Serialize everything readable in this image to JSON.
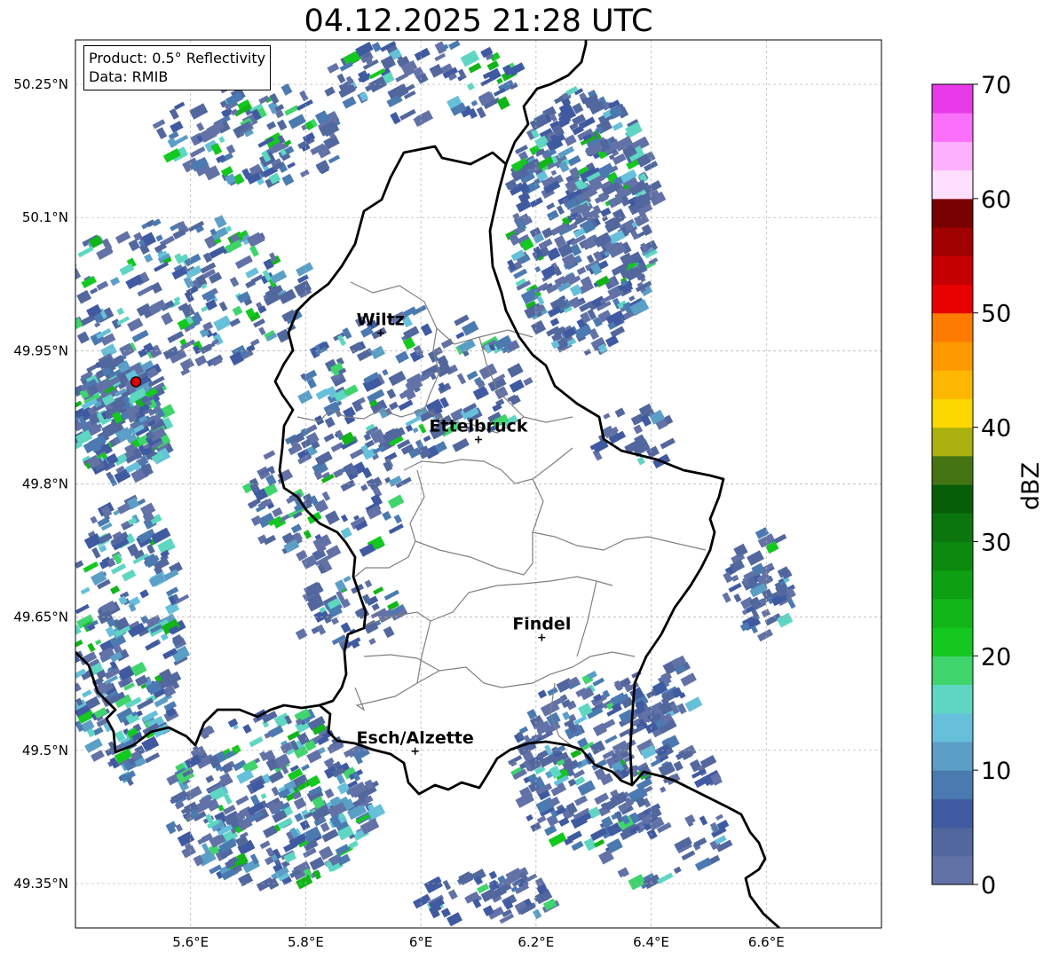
{
  "title": "04.12.2025 21:28 UTC",
  "info_box": {
    "product": "Product: 0.5° Reflectivity",
    "data": "Data: RMIB"
  },
  "map": {
    "lon_range": [
      5.4,
      6.8
    ],
    "lat_range": [
      49.3,
      50.3
    ],
    "x_ticks": [
      {
        "value": 5.6,
        "label": "5.6°E"
      },
      {
        "value": 5.8,
        "label": "5.8°E"
      },
      {
        "value": 6.0,
        "label": "6°E"
      },
      {
        "value": 6.2,
        "label": "6.2°E"
      },
      {
        "value": 6.4,
        "label": "6.4°E"
      },
      {
        "value": 6.6,
        "label": "6.6°E"
      }
    ],
    "y_ticks": [
      {
        "value": 50.25,
        "label": "50.25°N"
      },
      {
        "value": 50.1,
        "label": "50.1°N"
      },
      {
        "value": 49.95,
        "label": "49.95°N"
      },
      {
        "value": 49.8,
        "label": "49.8°N"
      },
      {
        "value": 49.65,
        "label": "49.65°N"
      },
      {
        "value": 49.5,
        "label": "49.5°N"
      },
      {
        "value": 49.35,
        "label": "49.35°N"
      }
    ],
    "grid": true,
    "cities": [
      {
        "name": "Wiltz",
        "lon": 5.93,
        "lat": 49.97
      },
      {
        "name": "Ettelbruck",
        "lon": 6.1,
        "lat": 49.85
      },
      {
        "name": "Findel",
        "lon": 6.21,
        "lat": 49.627
      },
      {
        "name": "Esch/Alzette",
        "lon": 5.99,
        "lat": 49.499
      }
    ],
    "radar_site": {
      "lon": 5.505,
      "lat": 49.915,
      "color": "#e00000"
    }
  },
  "colorbar": {
    "label": "dBZ",
    "min": 0,
    "max": 70,
    "step": 2.5,
    "tick_values": [
      0,
      10,
      20,
      30,
      40,
      50,
      60,
      70
    ],
    "tick_labels": [
      "0",
      "10",
      "20",
      "30",
      "40",
      "50",
      "60",
      "70"
    ],
    "colors": [
      "#6272a6",
      "#52679d",
      "#405aa1",
      "#4b7ab1",
      "#5b9ec6",
      "#66c0da",
      "#5ed6c2",
      "#3fd46c",
      "#13c81f",
      "#12b518",
      "#0e9f13",
      "#0c8a10",
      "#0a760d",
      "#075e09",
      "#457513",
      "#aab00d",
      "#fdd700",
      "#fdb700",
      "#fd9800",
      "#fd7b00",
      "#e80000",
      "#c50000",
      "#a00000",
      "#780000",
      "#fee0fe",
      "#fdb0fd",
      "#fb70fb",
      "#e83ae8"
    ]
  },
  "colors": {
    "country_border": "#000000",
    "admin_border": "#808080",
    "grid": "#b0b0b0"
  }
}
